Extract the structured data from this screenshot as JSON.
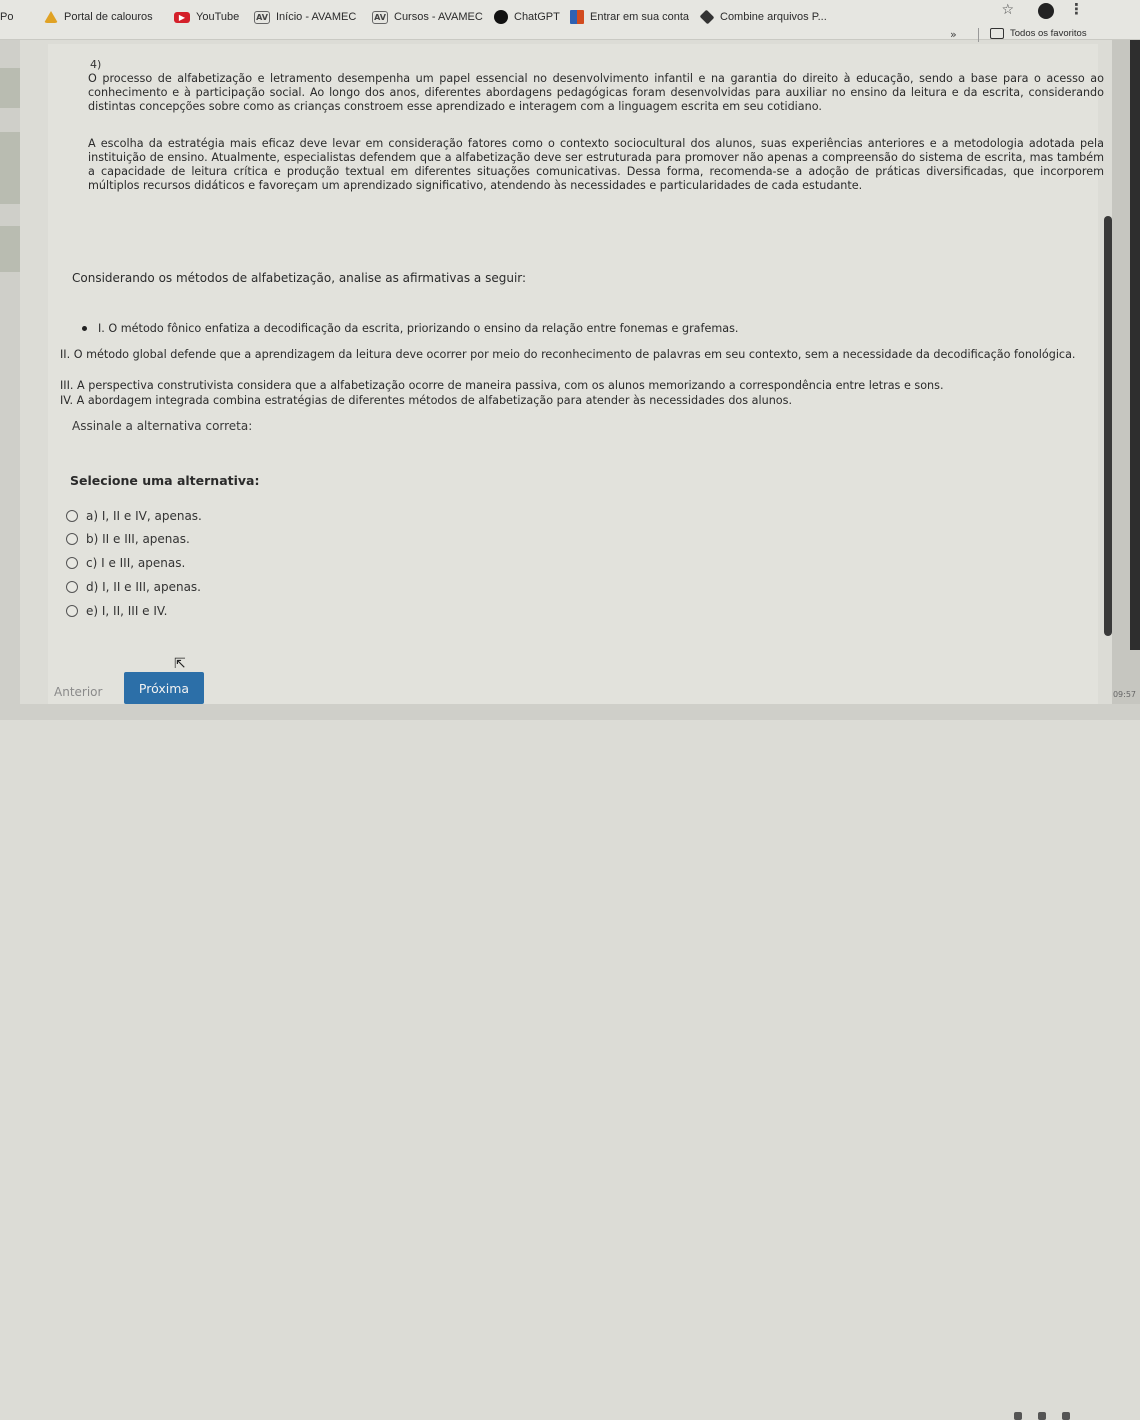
{
  "bookmarks_bar": {
    "items": [
      {
        "label": "Po",
        "icon": "page-icon"
      },
      {
        "label": "Portal de calouros",
        "icon": "triangle-logo-icon"
      },
      {
        "label": "YouTube",
        "icon": "youtube-icon"
      },
      {
        "label": "Início - AVAMEC",
        "icon": "avamec-icon"
      },
      {
        "label": "Cursos - AVAMEC",
        "icon": "avamec-icon"
      },
      {
        "label": "ChatGPT",
        "icon": "chatgpt-icon"
      },
      {
        "label": "Entrar em sua conta",
        "icon": "microsoft-icon"
      },
      {
        "label": "Combine arquivos P...",
        "icon": "combine-icon"
      }
    ],
    "overflow": "»",
    "all_bookmarks_label": "Todos os favoritos"
  },
  "question": {
    "number": "4)",
    "paragraph1": "O processo de alfabetização e letramento desempenha um papel essencial no desenvolvimento infantil e na garantia do direito à educação, sendo a base para o acesso ao conhecimento e à participação social. Ao longo dos anos, diferentes abordagens pedagógicas foram desenvolvidas para auxiliar no ensino da leitura e da escrita, considerando distintas concepções sobre como as crianças constroem esse aprendizado e interagem com a linguagem escrita em seu cotidiano.",
    "paragraph2": "A escolha da estratégia mais eficaz deve levar em consideração fatores como o contexto sociocultural dos alunos, suas experiências anteriores e a metodologia adotada pela instituição de ensino. Atualmente, especialistas defendem que a alfabetização deve ser estruturada para promover não apenas a compreensão do sistema de escrita, mas também a capacidade de leitura crítica e produção textual em diferentes situações comunicativas. Dessa forma, recomenda-se a adoção de práticas diversificadas, que incorporem múltiplos recursos didáticos e favoreçam um aprendizado significativo, atendendo às necessidades e particularidades de cada estudante.",
    "prompt": "Considerando os métodos de alfabetização, analise as afirmativas a seguir:",
    "statements": [
      "I. O método fônico enfatiza a decodificação da escrita, priorizando o ensino da relação entre fonemas e grafemas.",
      "II. O método global defende que a aprendizagem da leitura deve ocorrer por meio do reconhecimento de palavras em seu contexto, sem a necessidade da decodificação fonológica.",
      "III. A perspectiva construtivista considera que a alfabetização ocorre de maneira passiva, com os alunos memorizando a correspondência entre letras e sons.",
      "IV. A abordagem integrada combina estratégias de diferentes métodos de alfabetização para atender às necessidades dos alunos."
    ],
    "instruction": "Assinale a alternativa correta:",
    "select_label": "Selecione uma alternativa:",
    "options": [
      "a) I, II e IV, apenas.",
      "b) II e III, apenas.",
      "c) I e III, apenas.",
      "d) I, II e III, apenas.",
      "e) I, II, III e IV."
    ]
  },
  "navigation": {
    "previous_label": "Anterior",
    "next_label": "Próxima"
  },
  "system": {
    "clock": "09:57"
  },
  "colors": {
    "accent": "#2c6fa8",
    "background": "#e2e2dc"
  }
}
